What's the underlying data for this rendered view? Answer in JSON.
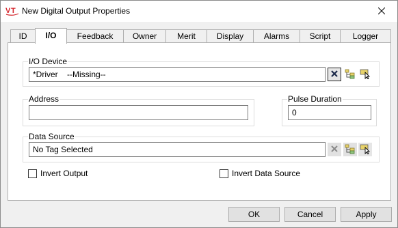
{
  "window": {
    "title": "New Digital Output Properties",
    "app_icon": "vt-logo-icon",
    "close_icon": "close-icon"
  },
  "tabs": [
    {
      "label": "ID",
      "active": false
    },
    {
      "label": "I/O",
      "active": true
    },
    {
      "label": "Feedback",
      "active": false
    },
    {
      "label": "Owner",
      "active": false
    },
    {
      "label": "Merit",
      "active": false
    },
    {
      "label": "Display",
      "active": false
    },
    {
      "label": "Alarms",
      "active": false
    },
    {
      "label": "Script",
      "active": false
    },
    {
      "label": "Logger",
      "active": false
    }
  ],
  "io_device": {
    "label": "I/O Device",
    "value": "*Driver    --Missing--",
    "clear_icon": "clear-x-icon",
    "browse_icon": "tree-browse-icon",
    "select_icon": "select-pointer-icon"
  },
  "address": {
    "label": "Address",
    "value": ""
  },
  "pulse_duration": {
    "label": "Pulse Duration",
    "value": "0"
  },
  "data_source": {
    "label": "Data Source",
    "value": "No Tag Selected",
    "clear_icon": "clear-x-icon",
    "browse_icon": "tree-browse-icon",
    "select_icon": "select-pointer-icon"
  },
  "invert_output": {
    "label": "Invert Output",
    "checked": false
  },
  "invert_data_source": {
    "label": "Invert Data Source",
    "checked": false
  },
  "buttons": {
    "ok": "OK",
    "cancel": "Cancel",
    "apply": "Apply"
  },
  "colors": {
    "accent": "#0078d7",
    "logo_red": "#d4262c"
  }
}
